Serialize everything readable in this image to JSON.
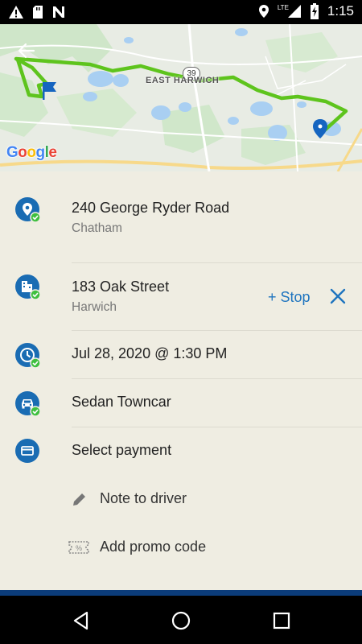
{
  "status_bar": {
    "time": "1:15",
    "network": "LTE",
    "icons": [
      "warning-icon",
      "sd-card-icon",
      "n-app-icon",
      "location-icon",
      "signal-icon",
      "battery-charging-icon"
    ]
  },
  "map": {
    "area_label": "EAST HARWICH",
    "route_number": "39",
    "attribution": "Google",
    "colors": {
      "route": "#5ec41d",
      "water": "#a9cff2",
      "pin": "#1565c0"
    }
  },
  "trip": {
    "pickup": {
      "address": "240 George Ryder Road",
      "town": "Chatham"
    },
    "dropoff": {
      "address": "183 Oak Street",
      "town": "Harwich",
      "add_stop_label": "+ Stop"
    },
    "datetime": "Jul 28, 2020 @ 1:30 PM",
    "vehicle": "Sedan Towncar",
    "payment": "Select payment",
    "note_label": "Note to driver",
    "promo_label": "Add promo code"
  },
  "theme": {
    "accent": "#1e74bf",
    "icon_blue": "#1a6cb3",
    "check_green": "#3fbf3f",
    "background": "#efede2"
  }
}
